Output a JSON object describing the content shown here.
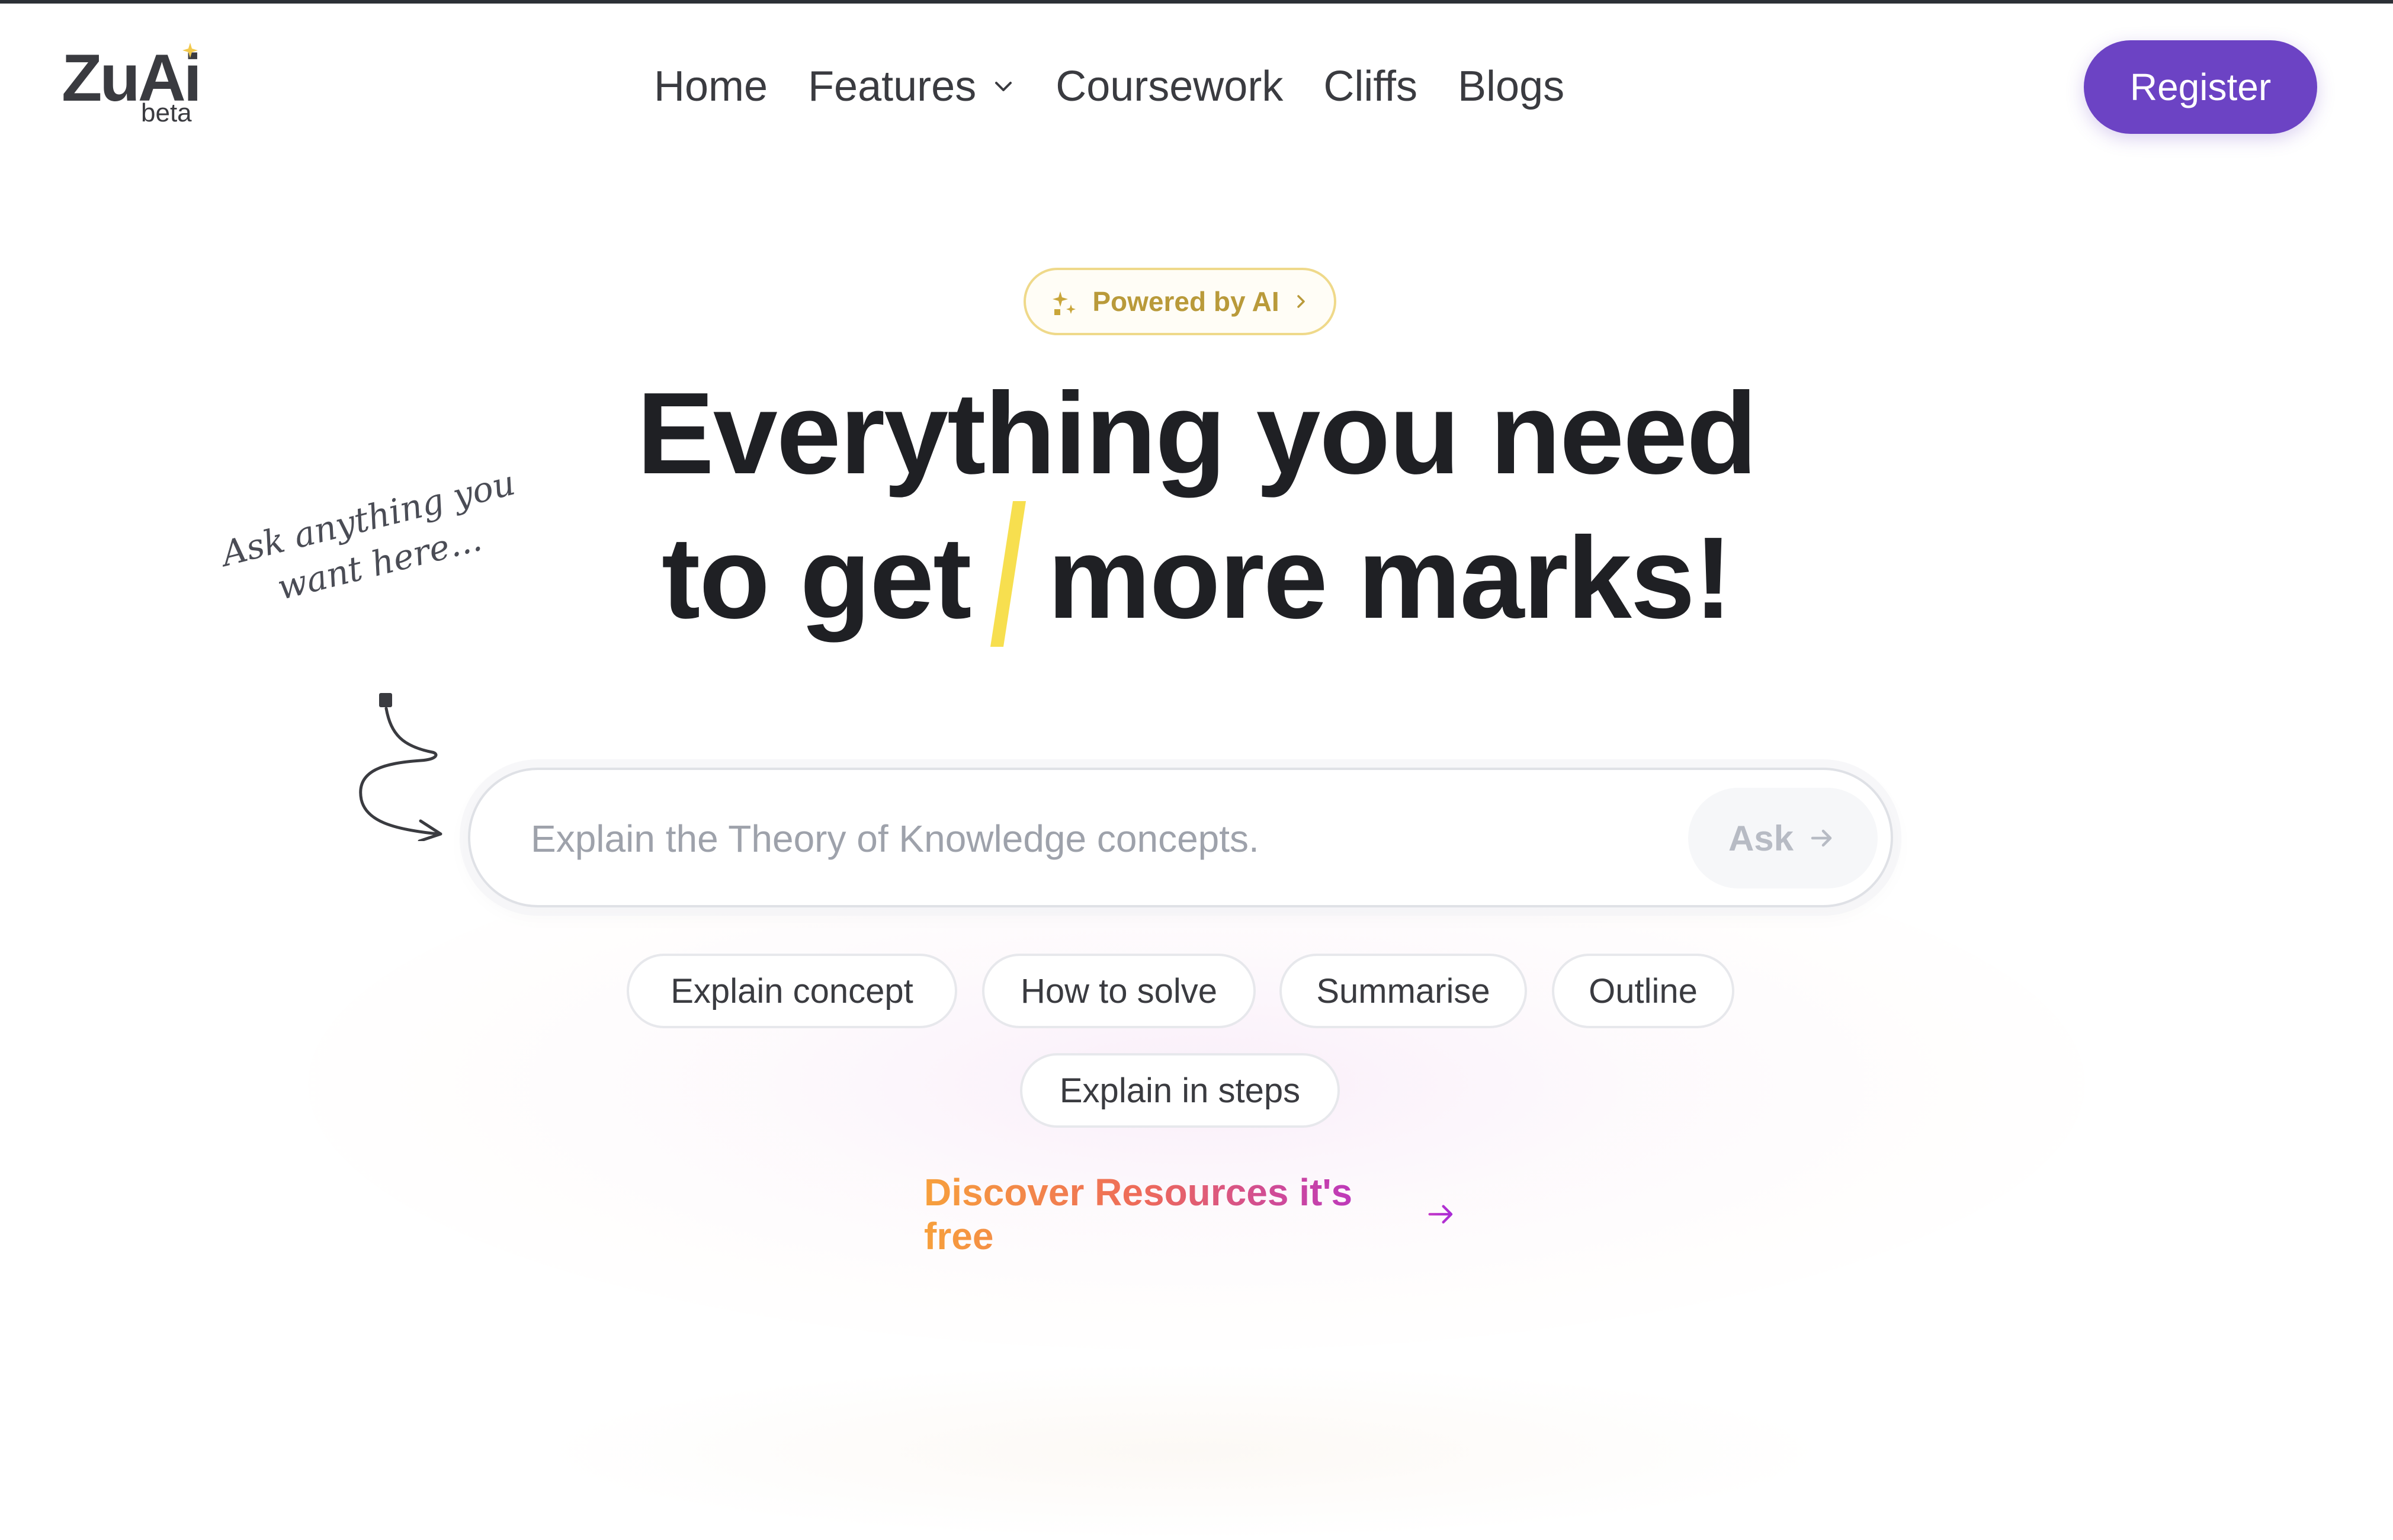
{
  "logo": {
    "name": "ZuAi",
    "tag": "beta"
  },
  "nav": {
    "items": [
      {
        "label": "Home"
      },
      {
        "label": "Features",
        "has_dropdown": true
      },
      {
        "label": "Coursework"
      },
      {
        "label": "Cliffs"
      },
      {
        "label": "Blogs"
      }
    ]
  },
  "header": {
    "register_label": "Register"
  },
  "badge": {
    "label": "Powered by AI",
    "icon": "sparkle-icon"
  },
  "hero": {
    "line1": "Everything you need",
    "line2_start": "to get",
    "line2_end": "more marks!"
  },
  "hint": {
    "line1": "Ask anything you",
    "line2": "want here..."
  },
  "search": {
    "placeholder": "Explain the Theory of Knowledge concepts.",
    "value": "",
    "ask_label": "Ask"
  },
  "chips": [
    {
      "label": "Explain concept"
    },
    {
      "label": "How to solve"
    },
    {
      "label": "Summarise"
    },
    {
      "label": "Outline"
    },
    {
      "label": "Explain in steps"
    }
  ],
  "discover": {
    "label": "Discover Resources it's free"
  },
  "colors": {
    "brand_purple": "#6c43c4",
    "badge_gold": "#b99a3a",
    "highlight_yellow": "#f7df4f",
    "gradient_start": "#f7a03c",
    "gradient_end": "#b02bd6"
  }
}
